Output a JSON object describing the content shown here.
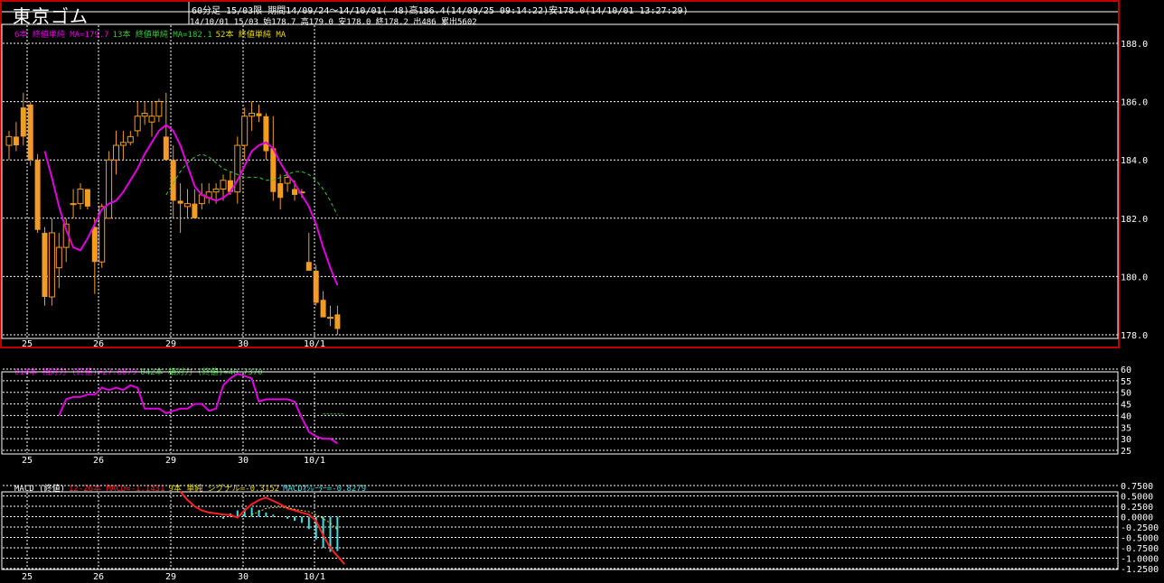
{
  "header": {
    "symbol": "東京ゴム",
    "line1": "60分足 15/03限 期間14/09/24～14/10/01( 48)高186.4(14/09/25 09:14:22)安178.0(14/10/01 13:27:29)",
    "line2": "14/10/01 15/03 始178.7 高179.0 安178.0 終178.2 出486 累出5602"
  },
  "colors": {
    "background": "#000000",
    "candle_up": "#f39c20",
    "ma6": "#e000e0",
    "ma13": "#3cc43c",
    "ma52": "#e8d800",
    "rsi14": "#e000e0",
    "rsi42": "#3cc43c",
    "macd": "#ff2020",
    "signal": "#e8d800",
    "osc": "#40e0e0",
    "frame": "#ffffff",
    "border_red": "#c00000"
  },
  "legends": {
    "price": [
      {
        "text": "6本 終値単純 MA=179.7",
        "color": "#e000e0"
      },
      {
        "text": "13本 終値単純 MA=182.1",
        "color": "#3cc43c"
      },
      {
        "text": "52本 終値単純 MA",
        "color": "#e8d800"
      }
    ],
    "rsi": [
      {
        "text": "014本 相対力 (終値)=27.8879",
        "color": "#e000e0"
      },
      {
        "text": "042本 相対力 (終値)=40.7370",
        "color": "#3cc43c"
      }
    ],
    "macd": [
      {
        "text": "MACD (終値)",
        "color": "#ffffff"
      },
      {
        "text": "12-26本 MACD=-1.1431",
        "color": "#ff2020"
      },
      {
        "text": "9本 単純 シグナル=-0.3152",
        "color": "#e8d800"
      },
      {
        "text": "MACDｵｼﾚｰﾀｰ=-0.8279",
        "color": "#40e0e0"
      }
    ]
  },
  "chart_data": [
    {
      "type": "candlestick",
      "title": "東京ゴム 60分足 15/03限",
      "x_labels": [
        "25",
        "26",
        "29",
        "30",
        "10/1"
      ],
      "ylim": [
        178.0,
        188.8
      ],
      "y_ticks": [
        "188.0",
        "186.0",
        "184.0",
        "182.0",
        "180.0",
        "178.0"
      ],
      "candles": [
        [
          184.5,
          185.0,
          184.0,
          184.8
        ],
        [
          184.8,
          185.3,
          184.3,
          184.5
        ],
        [
          185.8,
          186.3,
          184.5,
          184.8
        ],
        [
          185.9,
          186.0,
          183.8,
          184.0
        ],
        [
          184.0,
          184.2,
          181.5,
          181.6
        ],
        [
          181.5,
          181.7,
          179.0,
          179.3
        ],
        [
          179.3,
          182.0,
          179.0,
          181.5
        ],
        [
          180.3,
          181.5,
          179.6,
          181.0
        ],
        [
          181.0,
          182.0,
          180.5,
          181.8
        ],
        [
          182.5,
          183.0,
          182.0,
          182.5
        ],
        [
          182.5,
          183.2,
          182.3,
          183.0
        ],
        [
          183.0,
          183.0,
          182.3,
          182.4
        ],
        [
          181.7,
          182.0,
          179.4,
          180.5
        ],
        [
          180.5,
          182.5,
          180.3,
          182.4
        ],
        [
          182.0,
          184.3,
          182.0,
          184.0
        ],
        [
          184.0,
          185.0,
          183.5,
          184.5
        ],
        [
          184.5,
          185.0,
          184.0,
          184.6
        ],
        [
          184.6,
          185.0,
          184.5,
          184.8
        ],
        [
          185.0,
          186.0,
          184.8,
          185.5
        ],
        [
          185.5,
          186.0,
          185.2,
          185.6
        ],
        [
          185.3,
          186.0,
          184.8,
          185.5
        ],
        [
          185.5,
          186.1,
          185.3,
          186.0
        ],
        [
          184.8,
          186.3,
          184.5,
          184.0
        ],
        [
          184.0,
          184.5,
          182.0,
          182.6
        ],
        [
          182.6,
          183.2,
          181.5,
          182.5
        ],
        [
          182.4,
          183.0,
          182.0,
          182.5
        ],
        [
          182.5,
          183.0,
          182.0,
          182.0
        ],
        [
          182.5,
          183.2,
          182.3,
          182.8
        ],
        [
          182.7,
          183.2,
          182.5,
          182.9
        ],
        [
          182.9,
          183.2,
          182.5,
          183.0
        ],
        [
          183.0,
          183.5,
          182.6,
          183.3
        ],
        [
          183.3,
          183.6,
          182.8,
          182.9
        ],
        [
          182.9,
          184.8,
          182.5,
          184.5
        ],
        [
          184.5,
          185.8,
          184.0,
          185.5
        ],
        [
          185.5,
          186.0,
          185.0,
          185.6
        ],
        [
          185.6,
          185.9,
          185.3,
          185.5
        ],
        [
          185.5,
          185.6,
          184.0,
          184.3
        ],
        [
          184.4,
          185.5,
          182.6,
          182.9
        ],
        [
          183.2,
          183.5,
          182.3,
          182.7
        ],
        [
          183.2,
          183.6,
          182.9,
          183.4
        ],
        [
          183.0,
          183.3,
          182.6,
          182.8
        ],
        [
          182.9,
          183.0,
          182.7,
          182.9
        ],
        [
          180.5,
          181.5,
          180.2,
          180.2
        ],
        [
          180.2,
          180.4,
          179.0,
          179.1
        ],
        [
          179.2,
          179.5,
          178.7,
          178.6
        ],
        [
          178.6,
          179.0,
          178.3,
          178.6
        ],
        [
          178.7,
          179.0,
          178.0,
          178.2
        ]
      ],
      "ma6": [
        184.3,
        183.4,
        182.4,
        181.6,
        181.0,
        180.9,
        181.3,
        181.8,
        182.3,
        182.5,
        182.6,
        182.9,
        183.3,
        183.7,
        184.2,
        184.6,
        185.0,
        185.2,
        185.0,
        184.5,
        183.8,
        183.1,
        182.8,
        182.7,
        182.6,
        182.7,
        182.9,
        183.3,
        183.8,
        184.3,
        184.5,
        184.6,
        184.4,
        183.9,
        183.5,
        183.2,
        182.8,
        182.4,
        181.8,
        181.0,
        180.3,
        179.7
      ],
      "ma13": [
        182.8,
        183.2,
        183.6,
        183.9,
        184.1,
        184.2,
        184.1,
        183.9,
        183.7,
        183.6,
        183.5,
        183.4,
        183.4,
        183.4,
        183.3,
        183.3,
        183.4,
        183.5,
        183.6,
        183.6,
        183.5,
        183.3,
        183.0,
        182.6,
        182.1
      ]
    },
    {
      "type": "line",
      "title": "相対力 (終値)",
      "ylim": [
        25,
        60
      ],
      "y_ticks": [
        "60",
        "55",
        "50",
        "45",
        "40",
        "35",
        "30",
        "25"
      ],
      "series": [
        {
          "name": "014本 相対力 (終値)",
          "values": [
            40,
            47,
            48,
            48,
            49,
            49,
            52,
            51,
            52,
            51,
            53,
            52,
            43,
            43,
            43,
            41,
            42,
            43,
            43,
            45,
            45,
            42,
            43,
            53,
            56,
            58,
            57,
            56,
            46,
            47,
            47,
            47,
            47,
            46,
            39,
            33,
            31,
            30,
            30,
            28
          ]
        },
        {
          "name": "042本 相対力 (終値)",
          "values": [
            40.7,
            40.7,
            40.7,
            40.7
          ]
        }
      ]
    },
    {
      "type": "line",
      "title": "MACD (終値)",
      "ylim": [
        -1.25,
        0.75
      ],
      "y_ticks": [
        "0.7500",
        "0.5000",
        "0.2500",
        "0.0000",
        "-0.2500",
        "-0.5000",
        "-0.7500",
        "-1.0000",
        "-1.2500"
      ],
      "series": [
        {
          "name": "12-26本 MACD",
          "values": [
            0.6,
            0.4,
            0.25,
            0.15,
            0.1,
            0.08,
            0.05,
            0.04,
            -0.02,
            0.15,
            0.3,
            0.4,
            0.46,
            0.38,
            0.3,
            0.2,
            0.15,
            0.1,
            0.05,
            -0.1,
            -0.45,
            -0.75,
            -0.95,
            -1.1431
          ]
        },
        {
          "name": "9本 単純 シグナル",
          "values": [
            0.05,
            0.12,
            0.2,
            0.22,
            0.23,
            0.22,
            0.18,
            0.15,
            0.12,
            0.05,
            -0.05,
            -0.15,
            -0.3152
          ]
        },
        {
          "name": "MACDｵｼﾚｰﾀｰ",
          "values": [
            -0.05,
            0.08,
            0.15,
            0.2,
            0.22,
            0.16,
            0.1,
            0.05,
            0.0,
            -0.05,
            -0.1,
            -0.15,
            -0.3,
            -0.55,
            -0.75,
            -0.85,
            -0.8279
          ]
        }
      ]
    }
  ]
}
